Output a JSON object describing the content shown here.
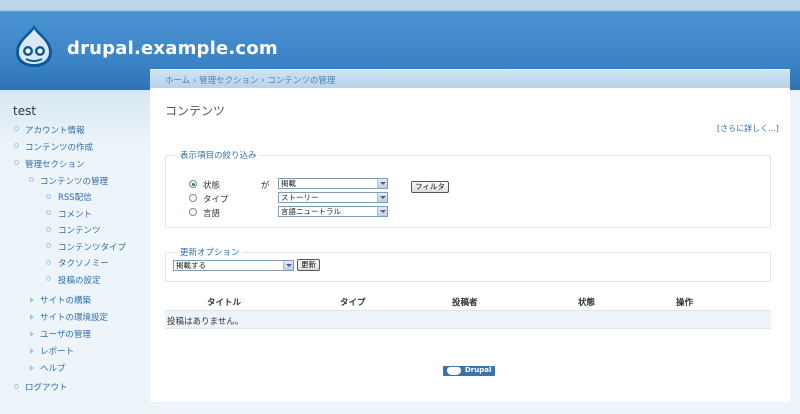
{
  "site": {
    "name": "drupal.example.com"
  },
  "breadcrumb": [
    "ホーム",
    "管理セクション",
    "コンテンツの管理"
  ],
  "breadcrumb_sep": "›",
  "sidebar": {
    "user": "test",
    "items": [
      {
        "label": "アカウント情報"
      },
      {
        "label": "コンテンツの作成"
      },
      {
        "label": "管理セクション"
      },
      {
        "label": "コンテンツの管理"
      },
      {
        "label": "RSS配信"
      },
      {
        "label": "コメント"
      },
      {
        "label": "コンテンツ"
      },
      {
        "label": "コンテンツタイプ"
      },
      {
        "label": "タクソノミー"
      },
      {
        "label": "投稿の設定"
      },
      {
        "label": "サイトの構築"
      },
      {
        "label": "サイトの環境設定"
      },
      {
        "label": "ユーザの管理"
      },
      {
        "label": "レポート"
      },
      {
        "label": "ヘルプ"
      },
      {
        "label": "ログアウト"
      }
    ]
  },
  "page": {
    "title": "コンテンツ",
    "more_link": "[さらに詳しく...]"
  },
  "filter": {
    "legend": "表示項目の絞り込み",
    "rows": [
      {
        "label": "状態",
        "value": "掲載"
      },
      {
        "label": "タイプ",
        "value": "ストーリー"
      },
      {
        "label": "言語",
        "value": "言語ニュートラル"
      }
    ],
    "connector": "が",
    "selected_index": 0,
    "button": "フィルタ"
  },
  "update": {
    "legend": "更新オプション",
    "value": "掲載する",
    "button": "更新"
  },
  "table": {
    "headers": [
      "タイトル",
      "タイプ",
      "投稿者",
      "状態",
      "操作"
    ],
    "empty": "投稿はありません。"
  },
  "footer": {
    "badge": "Drupal"
  },
  "colors": {
    "header": "#3d84c6",
    "link": "#2f6da8",
    "background": "#edf5fa"
  }
}
